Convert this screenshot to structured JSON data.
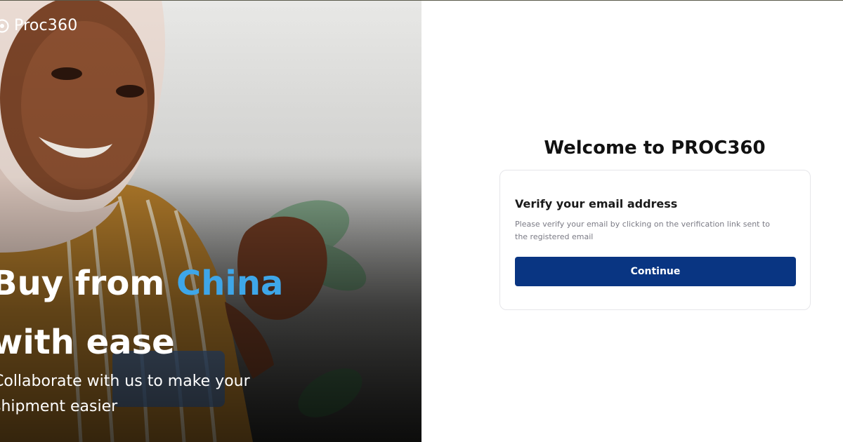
{
  "brand": {
    "name": "Proc360",
    "logo_icon": "proc360-logo-icon"
  },
  "hero": {
    "title_line1_prefix": "Buy from ",
    "title_line1_accent": "China",
    "title_line2": "with ease",
    "subtitle": "Collaborate with us to make your shipment easier",
    "accent_color": "#3ea6e8"
  },
  "panel": {
    "welcome": "Welcome to PROC360",
    "card": {
      "title": "Verify your email address",
      "description": "Please verify your email by clicking on the verification link sent to the registered email",
      "continue_label": "Continue"
    },
    "button_color": "#093582"
  }
}
